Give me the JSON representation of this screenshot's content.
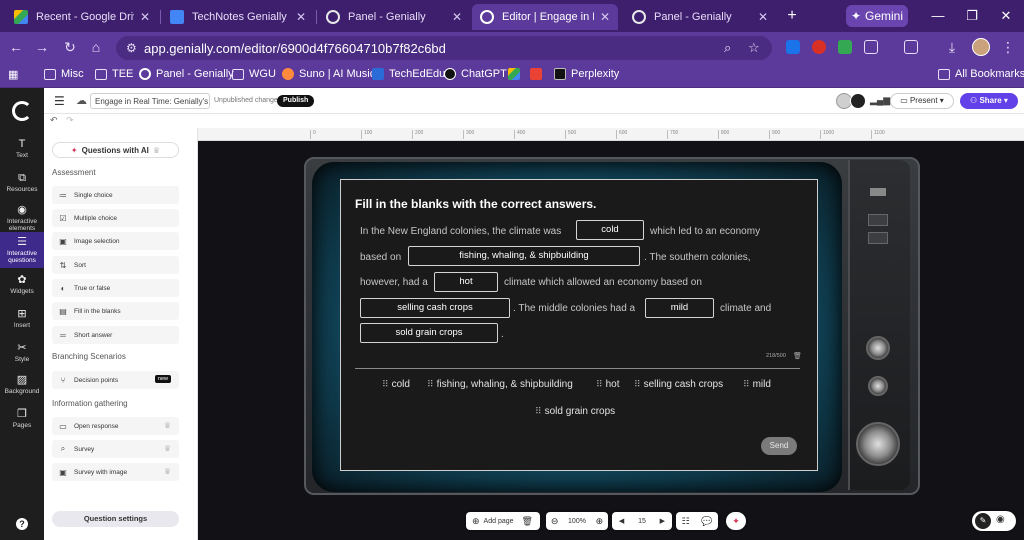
{
  "browser": {
    "tabs": [
      {
        "title": "Recent - Google Drive",
        "favicon_color": "#34a853"
      },
      {
        "title": "TechNotes Genially Live -",
        "favicon_color": "#4285f4"
      },
      {
        "title": "Panel - Genially",
        "favicon_color": "#e8e8e8"
      },
      {
        "title": "Editor | Engage in Real Ti",
        "favicon_color": "#e8e8e8"
      },
      {
        "title": "Panel - Genially",
        "favicon_color": "#e8e8e8"
      }
    ],
    "new_tab_label": "+",
    "gemini_label": "Gemini",
    "window_controls": {
      "minimize": "—",
      "maximize": "❐",
      "close": "✕"
    },
    "url": "app.genially.com/editor/6900d4f76604710b7f82c6bd",
    "bookmarks": [
      {
        "label": "Misc",
        "icon": "folder-icon"
      },
      {
        "label": "TEE",
        "icon": "folder-icon"
      },
      {
        "label": "Panel - Genially",
        "icon": "genially-icon"
      },
      {
        "label": "WGU",
        "icon": "folder-icon"
      },
      {
        "label": "Suno | AI Music",
        "icon": "suno-icon"
      },
      {
        "label": "TechEdEdu",
        "icon": "techededu-icon"
      },
      {
        "label": "ChatGPT",
        "icon": "chatgpt-icon"
      },
      {
        "label": "Perplexity",
        "icon": "perplexity-icon"
      }
    ],
    "all_bookmarks_label": "All Bookmarks"
  },
  "rail": {
    "items": [
      {
        "label": "Text",
        "icon": "text-icon"
      },
      {
        "label": "Resources",
        "icon": "resources-icon"
      },
      {
        "label": "Interactive elements",
        "icon": "interactive-elements-icon"
      },
      {
        "label": "Interactive questions",
        "icon": "interactive-questions-icon"
      },
      {
        "label": "Widgets",
        "icon": "widgets-icon"
      },
      {
        "label": "Insert",
        "icon": "insert-icon"
      },
      {
        "label": "Style",
        "icon": "style-icon"
      },
      {
        "label": "Background",
        "icon": "background-icon"
      },
      {
        "label": "Pages",
        "icon": "pages-icon"
      }
    ],
    "help": "?"
  },
  "topbar": {
    "doc_name": "Engage in Real Time: Genially's",
    "unsaved": "Unpublished changes",
    "publish": "Publish",
    "present": "Present",
    "share": "Share"
  },
  "panel": {
    "ai_button": "Questions with AI",
    "assessment_heading": "Assessment",
    "assessment": [
      "Single choice",
      "Multiple choice",
      "Image selection",
      "Sort",
      "True or false",
      "Fill in the blanks",
      "Short answer"
    ],
    "branching_heading": "Branching Scenarios",
    "branching": [
      "Decision points"
    ],
    "new_badge": "new",
    "info_heading": "Information gathering",
    "info": [
      "Open response",
      "Survey",
      "Survey with image"
    ],
    "settings": "Question settings"
  },
  "ruler": [
    "0",
    "100",
    "200",
    "300",
    "400",
    "500",
    "600",
    "700",
    "800",
    "900",
    "1000",
    "1100"
  ],
  "question": {
    "title": "Fill in the blanks with the correct answers.",
    "t1": "In the New England colonies, the climate was",
    "t2": "which led to an economy",
    "t3": "based on",
    "t4": ". The southern colonies,",
    "t5": "however, had a",
    "t6": "climate which allowed an economy based on",
    "t7": ". The middle colonies had a",
    "t8": "climate and",
    "t9": ".",
    "blanks": [
      "cold",
      "fishing, whaling, & shipbuilding",
      "hot",
      "selling cash crops",
      "mild",
      "sold grain crops"
    ],
    "char_count": "218/500",
    "options": [
      "cold",
      "fishing, whaling, & shipbuilding",
      "hot",
      "selling cash crops",
      "mild",
      "sold grain crops"
    ],
    "send": "Send"
  },
  "bottom": {
    "add_page": "Add page",
    "zoom": "100%",
    "page": "15"
  }
}
